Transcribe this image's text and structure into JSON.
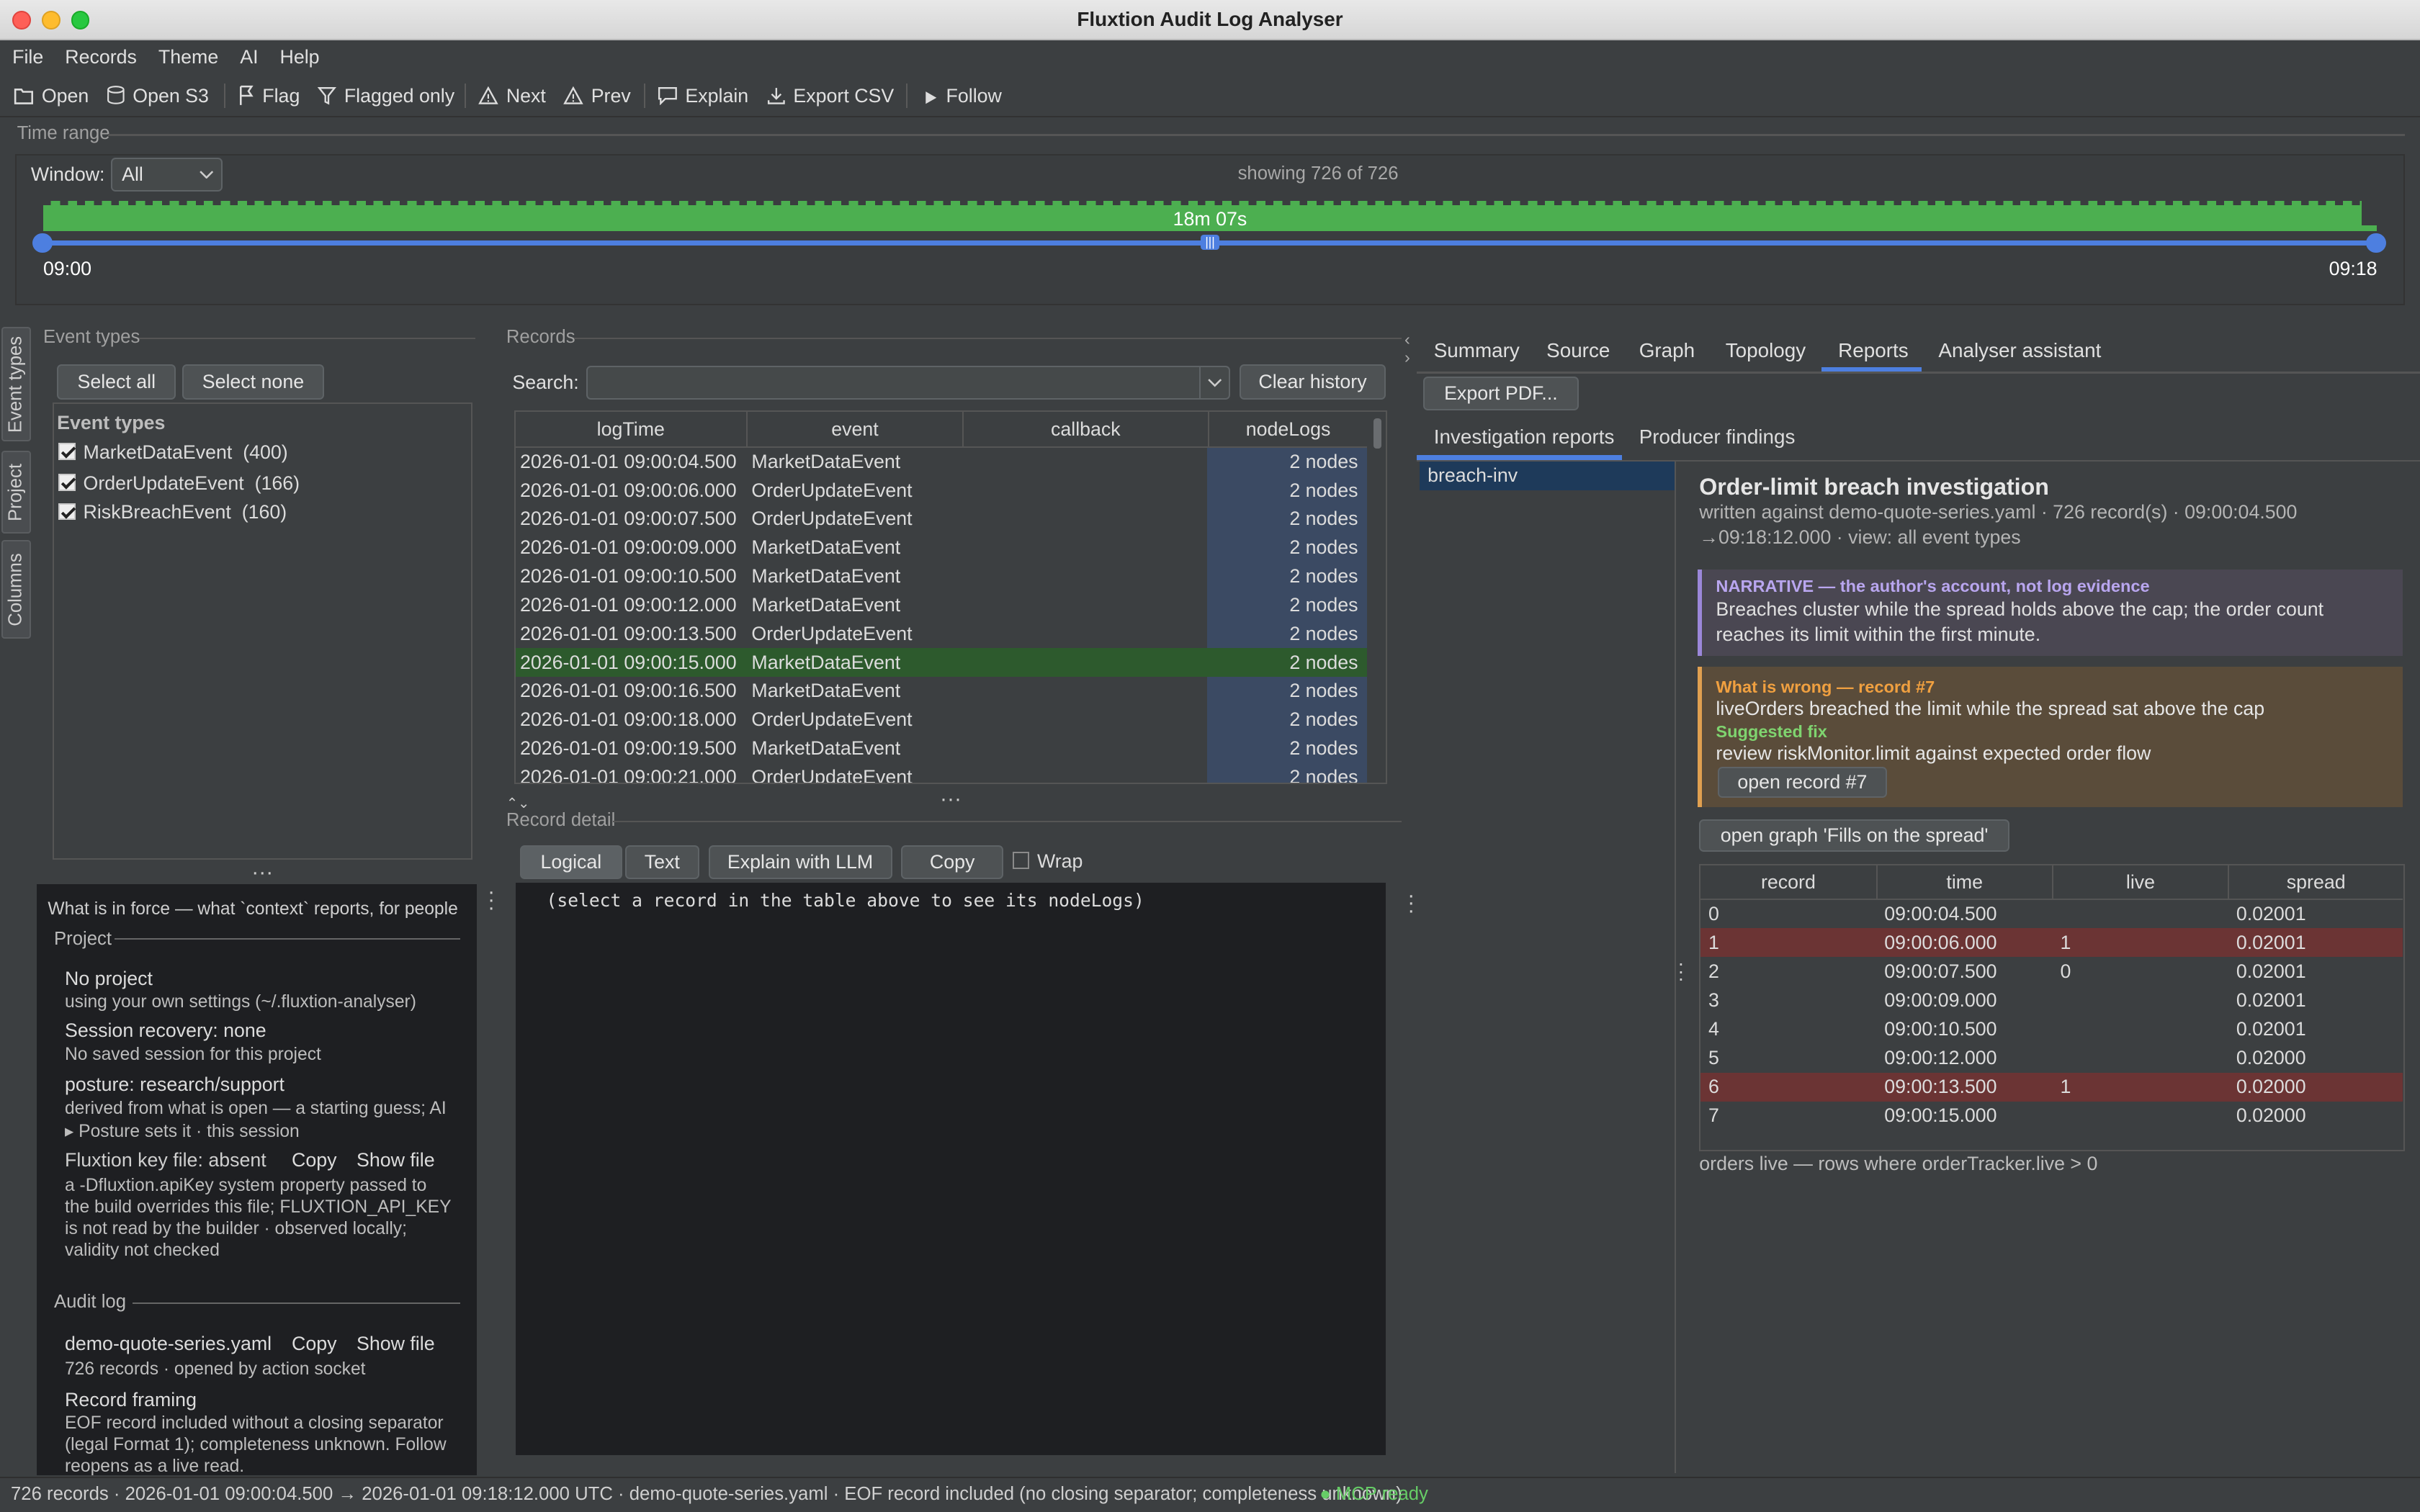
{
  "window": {
    "title": "Fluxtion Audit Log Analyser"
  },
  "menu": [
    "File",
    "Records",
    "Theme",
    "AI",
    "Help"
  ],
  "toolbar": {
    "open": "Open",
    "open_s3": "Open S3",
    "flag": "Flag",
    "flagged_only": "Flagged only",
    "next": "Next",
    "prev": "Prev",
    "explain": "Explain",
    "export_csv": "Export CSV",
    "follow": "Follow"
  },
  "time_range": {
    "section": "Time range",
    "window_label": "Window:",
    "window_value": "All",
    "showing": "showing 726 of 726",
    "duration": "18m 07s",
    "start": "09:00",
    "end": "09:18",
    "selected_fraction": 1.0
  },
  "event_types": {
    "section": "Event types",
    "select_all": "Select all",
    "select_none": "Select none",
    "header": "Event types",
    "items": [
      {
        "name": "MarketDataEvent",
        "count": "(400)",
        "checked": true
      },
      {
        "name": "OrderUpdateEvent",
        "count": "(166)",
        "checked": true
      },
      {
        "name": "RiskBreachEvent",
        "count": "(160)",
        "checked": true
      }
    ]
  },
  "side_tabs": [
    "Event types",
    "Project",
    "Columns"
  ],
  "context": {
    "heading": "What is in force — what `context` reports, for people",
    "project_section": "Project",
    "no_project": "No project",
    "no_project_sub": "using your own settings (~/.fluxtion-analyser)",
    "session": "Session recovery: none",
    "session_sub": "No saved session for this project",
    "posture": "posture: research/support",
    "posture_sub1": "derived from what is open — a starting guess; AI",
    "posture_sub2": "▸ Posture sets it · this session",
    "key_file": "Fluxtion key file: absent",
    "copy": "Copy",
    "show_file": "Show file",
    "key_sub": [
      "a -Dfluxtion.apiKey system property passed to",
      "the build overrides this file; FLUXTION_API_KEY",
      "is not read by the builder · observed locally;",
      "validity not checked"
    ],
    "audit_section": "Audit log",
    "audit_file": "demo-quote-series.yaml",
    "audit_sub": "726 records · opened by action socket",
    "framing": "Record framing",
    "framing_sub": [
      "EOF record included without a closing separator",
      "(legal Format 1); completeness unknown. Follow",
      "reopens as a live read."
    ]
  },
  "records": {
    "section": "Records",
    "search_label": "Search:",
    "search_value": "",
    "clear_history": "Clear history",
    "columns": [
      "logTime",
      "event",
      "callback",
      "nodeLogs"
    ],
    "rows": [
      [
        "2026-01-01 09:00:04.500",
        "MarketDataEvent",
        "",
        "2 nodes"
      ],
      [
        "2026-01-01 09:00:06.000",
        "OrderUpdateEvent",
        "",
        "2 nodes"
      ],
      [
        "2026-01-01 09:00:07.500",
        "OrderUpdateEvent",
        "",
        "2 nodes"
      ],
      [
        "2026-01-01 09:00:09.000",
        "MarketDataEvent",
        "",
        "2 nodes"
      ],
      [
        "2026-01-01 09:00:10.500",
        "MarketDataEvent",
        "",
        "2 nodes"
      ],
      [
        "2026-01-01 09:00:12.000",
        "MarketDataEvent",
        "",
        "2 nodes"
      ],
      [
        "2026-01-01 09:00:13.500",
        "OrderUpdateEvent",
        "",
        "2 nodes"
      ],
      [
        "2026-01-01 09:00:15.000",
        "MarketDataEvent",
        "",
        "2 nodes"
      ],
      [
        "2026-01-01 09:00:16.500",
        "MarketDataEvent",
        "",
        "2 nodes"
      ],
      [
        "2026-01-01 09:00:18.000",
        "OrderUpdateEvent",
        "",
        "2 nodes"
      ],
      [
        "2026-01-01 09:00:19.500",
        "MarketDataEvent",
        "",
        "2 nodes"
      ],
      [
        "2026-01-01 09:00:21.000",
        "OrderUpdateEvent",
        "",
        "2 nodes"
      ]
    ],
    "selected_row": 7
  },
  "detail": {
    "section": "Record detail",
    "tabs": [
      "Logical",
      "Text"
    ],
    "explain": "Explain with LLM",
    "copy": "Copy",
    "wrap": "Wrap",
    "placeholder": "(select a record in the table above to see its nodeLogs)"
  },
  "right": {
    "tabs": [
      "Summary",
      "Source",
      "Graph",
      "Topology",
      "Reports",
      "Analyser assistant"
    ],
    "active_tab": "Reports",
    "export_pdf": "Export PDF...",
    "subtabs": [
      "Investigation reports",
      "Producer findings"
    ],
    "list": [
      "breach-inv"
    ],
    "report": {
      "title": "Order-limit breach investigation",
      "meta1": "written against demo-quote-series.yaml · 726 record(s) · 09:00:04.500",
      "meta2": "→09:18:12.000 · view: all event types",
      "narrative_head": "NARRATIVE — the author's account, not log evidence",
      "narrative": [
        "Breaches cluster while the spread holds above the cap; the order count",
        "reaches its limit within the first minute."
      ],
      "wrong_head": "What is wrong — record #7",
      "wrong": "liveOrders breached the limit while the spread sat above the cap",
      "fix_head": "Suggested fix",
      "fix": "review riskMonitor.limit against expected order flow",
      "open_record": "open record #7",
      "open_graph": "open graph 'Fills on the spread'",
      "table": {
        "columns": [
          "record",
          "time",
          "live",
          "spread"
        ],
        "rows": [
          [
            "0",
            "09:00:04.500",
            "",
            "0.02001"
          ],
          [
            "1",
            "09:00:06.000",
            "1",
            "0.02001"
          ],
          [
            "2",
            "09:00:07.500",
            "0",
            "0.02001"
          ],
          [
            "3",
            "09:00:09.000",
            "",
            "0.02001"
          ],
          [
            "4",
            "09:00:10.500",
            "",
            "0.02001"
          ],
          [
            "5",
            "09:00:12.000",
            "",
            "0.02000"
          ],
          [
            "6",
            "09:00:13.500",
            "1",
            "0.02000"
          ],
          [
            "7",
            "09:00:15.000",
            "",
            "0.02000"
          ]
        ],
        "highlighted": [
          1,
          6
        ]
      },
      "caption": "orders live — rows where orderTracker.live > 0"
    }
  },
  "status": {
    "text": "726 records · 2026-01-01 09:00:04.500 → 2026-01-01 09:18:12.000 UTC · demo-quote-series.yaml · EOF record included (no closing separator; completeness unknown)",
    "mcp": "● MCP ready"
  },
  "colors": {
    "green": "#4caf50",
    "blue": "#4d7fe0",
    "selected_row": "#2d5a2d",
    "highlight_row": "#6b3434"
  }
}
